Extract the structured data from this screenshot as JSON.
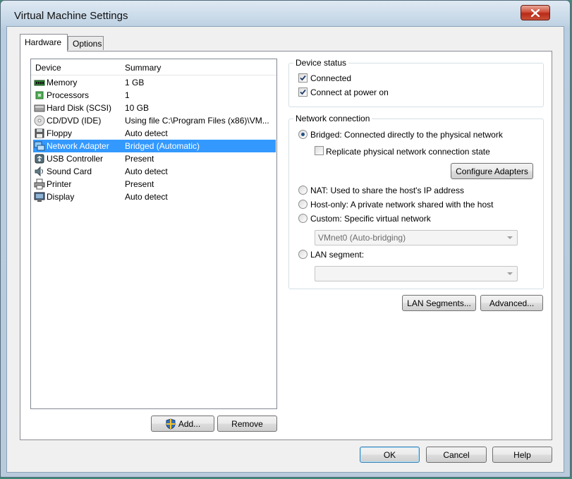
{
  "window": {
    "title": "Virtual Machine Settings"
  },
  "tabs": [
    {
      "label": "Hardware"
    },
    {
      "label": "Options"
    }
  ],
  "device_list": {
    "columns": {
      "device": "Device",
      "summary": "Summary"
    },
    "rows": [
      {
        "icon": "memory-icon",
        "name": "Memory",
        "summary": "1 GB"
      },
      {
        "icon": "processor-icon",
        "name": "Processors",
        "summary": "1"
      },
      {
        "icon": "hard-disk-icon",
        "name": "Hard Disk (SCSI)",
        "summary": "10 GB"
      },
      {
        "icon": "cd-dvd-icon",
        "name": "CD/DVD (IDE)",
        "summary": "Using file C:\\Program Files (x86)\\VM..."
      },
      {
        "icon": "floppy-icon",
        "name": "Floppy",
        "summary": "Auto detect"
      },
      {
        "icon": "network-adapter-icon",
        "name": "Network Adapter",
        "summary": "Bridged (Automatic)"
      },
      {
        "icon": "usb-icon",
        "name": "USB Controller",
        "summary": "Present"
      },
      {
        "icon": "sound-card-icon",
        "name": "Sound Card",
        "summary": "Auto detect"
      },
      {
        "icon": "printer-icon",
        "name": "Printer",
        "summary": "Present"
      },
      {
        "icon": "display-icon",
        "name": "Display",
        "summary": "Auto detect"
      }
    ],
    "selected_index": 5
  },
  "list_buttons": {
    "add": "Add...",
    "remove": "Remove"
  },
  "device_status": {
    "title": "Device status",
    "connected": "Connected",
    "connect_at_power_on": "Connect at power on"
  },
  "network_connection": {
    "title": "Network connection",
    "bridged": "Bridged: Connected directly to the physical network",
    "replicate": "Replicate physical network connection state",
    "configure_adapters": "Configure Adapters",
    "nat": "NAT: Used to share the host's IP address",
    "host_only": "Host-only: A private network shared with the host",
    "custom": "Custom: Specific virtual network",
    "custom_select": "VMnet0 (Auto-bridging)",
    "lan_segment": "LAN segment:",
    "lan_select": ""
  },
  "panel_buttons": {
    "lan_segments": "LAN Segments...",
    "advanced": "Advanced..."
  },
  "dialog_buttons": {
    "ok": "OK",
    "cancel": "Cancel",
    "help": "Help"
  }
}
